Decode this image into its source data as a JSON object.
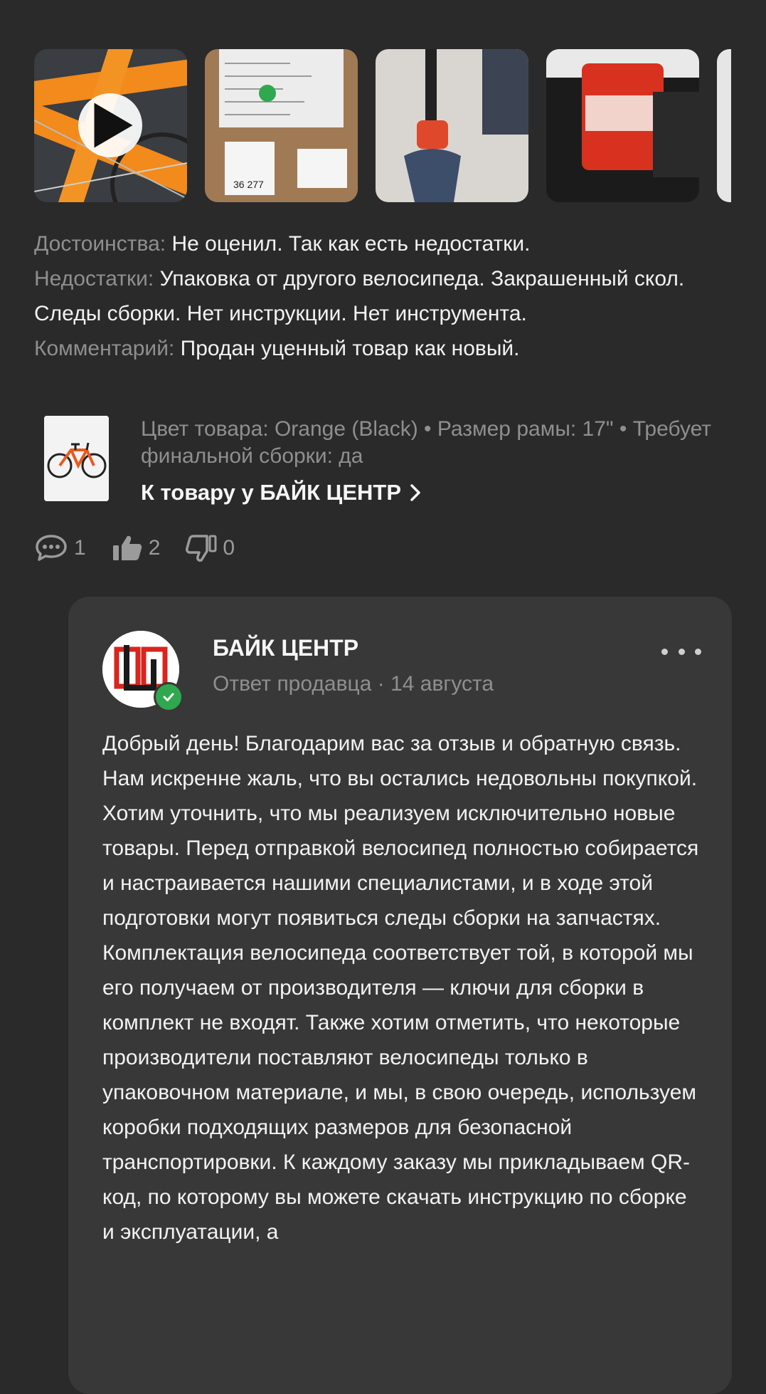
{
  "media": {
    "thumbnails": [
      {
        "name": "video-thumbnail-bike-frame",
        "has_play": true
      },
      {
        "name": "photo-thumbnail-box-labels",
        "has_play": false
      },
      {
        "name": "photo-thumbnail-bike-part",
        "has_play": false
      },
      {
        "name": "photo-thumbnail-reflector",
        "has_play": false
      },
      {
        "name": "photo-thumbnail-partial",
        "has_play": false
      }
    ]
  },
  "review": {
    "pros_label": "Достоинства:",
    "pros_text": " Не оценил. Так как есть недостатки.",
    "cons_label": "Недостатки:",
    "cons_text": " Упаковка от другого велосипеда. Закрашенный скол. Следы сборки. Нет инструкции.  Нет инструмента.",
    "comment_label": "Комментарий:",
    "comment_text": " Продан уценный товар как новый."
  },
  "product": {
    "meta": "Цвет товара: Orange (Black) • Размер рамы: 17\" • Требует финальной сборки: да",
    "link_text": "К товару у БАЙК ЦЕНТР"
  },
  "actions": {
    "comments_count": "1",
    "likes_count": "2",
    "dislikes_count": "0"
  },
  "seller": {
    "name": "БАЙК ЦЕНТР",
    "subtitle": "Ответ продавца · 14 августа",
    "reply": "Добрый день! Благодарим вас за отзыв и обратную связь. Нам искренне жаль, что вы остались недовольны покупкой. Хотим уточнить, что мы реализуем исключительно новые товары. Перед отправкой велосипед полностью собирается и настраивается нашими специалистами, и в ходе этой подготовки могут появиться следы сборки на запчастях. Комплектация велосипеда соответствует той, в которой мы его получаем от производителя — ключи для сборки в комплект не входят. Также хотим отметить, что некоторые производители поставляют велосипеды только в упаковочном материале, и мы, в свою очередь, используем коробки подходящих размеров для безопасной транспортировки. К каждому заказу мы прикладываем QR-код, по которому вы можете скачать инструкцию по сборке и эксплуатации, а"
  },
  "colors": {
    "background": "#2a2a2a",
    "card": "#383838",
    "muted_text": "#8f8f8f",
    "primary_text": "#f2f2f2",
    "verified_green": "#2fa84f",
    "accent_orange": "#f28a1c"
  }
}
